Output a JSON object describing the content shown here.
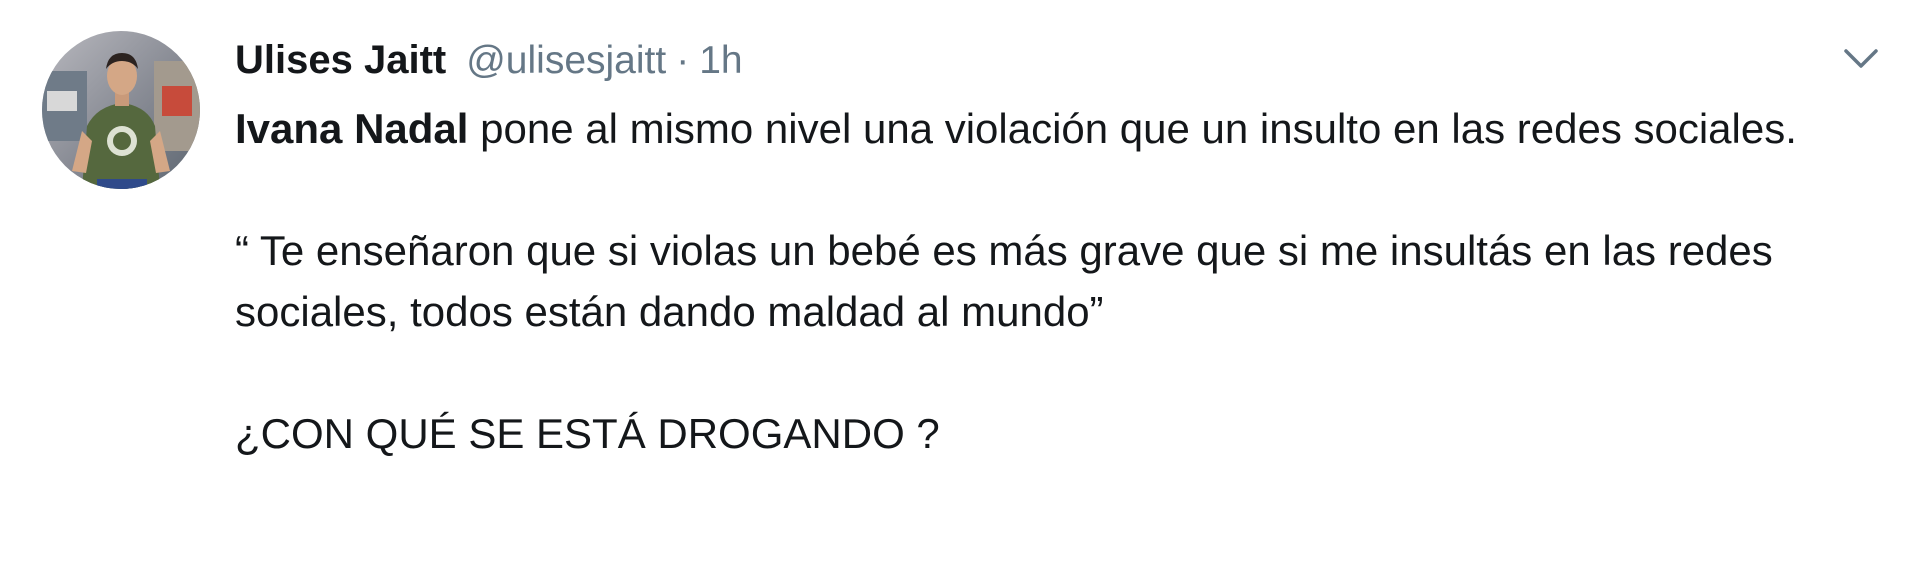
{
  "tweet": {
    "author_name": "Ulises Jaitt",
    "author_handle": "@ulisesjaitt",
    "separator": "·",
    "timestamp": "1h",
    "mention": "Ivana Nadal",
    "line1_rest": " pone al mismo nivel una violación que un insulto en las redes sociales.",
    "quote": "“ Te enseñaron que si violas un bebé es más grave que si me insultás en las redes sociales, todos están dando maldad al mundo”",
    "question": "¿CON QUÉ SE ESTÁ DROGANDO ?"
  },
  "icons": {
    "menu": "chevron-down-icon",
    "avatar": "profile-photo"
  },
  "colors": {
    "text_primary": "#14171a",
    "text_secondary": "#657786",
    "background": "#ffffff"
  }
}
